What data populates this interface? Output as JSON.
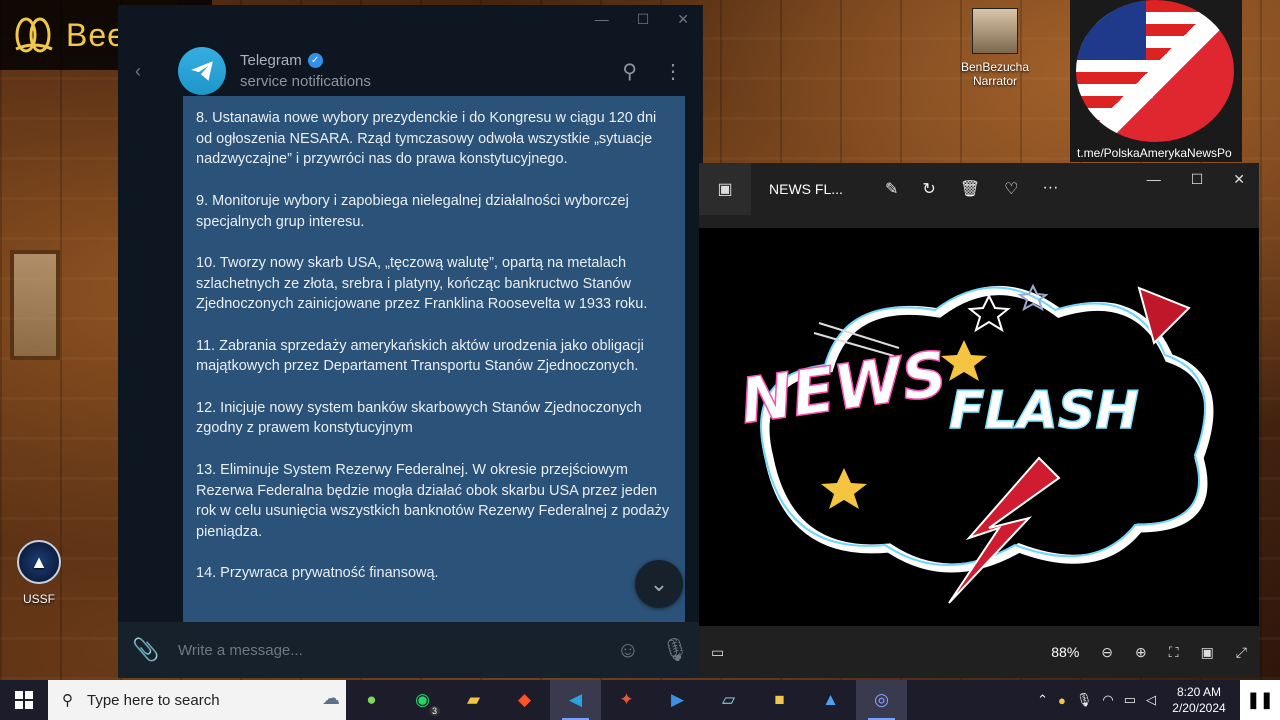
{
  "watermark": {
    "brand": "BeeCut"
  },
  "telegram": {
    "chat_name": "Telegram",
    "chat_status": "service notifications",
    "message_paragraphs": [
      "8. Ustanawia nowe wybory prezydenckie i do Kongresu w ciągu 120 dni od ogłoszenia NESARA. Rząd tymczasowy odwoła wszystkie „sytuacje nadzwyczajne” i przywróci nas do prawa konstytucyjnego.",
      "9. Monitoruje wybory i zapobiega nielegalnej działalności wyborczej specjalnych grup interesu.",
      "10. Tworzy nowy skarb USA, „tęczową walutę”, opartą na metalach szlachetnych ze złota, srebra i platyny, kończąc bankructwo Stanów Zjednoczonych zainicjowane przez Franklina Roosevelta w 1933 roku.",
      "11. Zabrania sprzedaży amerykańskich aktów urodzenia jako obligacji majątkowych przez Departament Transportu Stanów Zjednoczonych.",
      "12. Inicjuje nowy system banków skarbowych Stanów Zjednoczonych zgodny z prawem konstytucyjnym",
      "13. Eliminuje System Rezerwy Federalnej. W okresie przejściowym Rezerwa Federalna będzie mogła działać obok skarbu USA przez jeden rok w celu usunięcia wszystkich banknotów Rezerwy Federalnej z podaży pieniądza.",
      "14. Przywraca prywatność finansową."
    ],
    "composer_placeholder": "Write a message..."
  },
  "desktop": {
    "ussf_label": "USSF",
    "narrator_name": "BenBezucha",
    "narrator_role": "Narrator",
    "channel_url": "t.me/PolskaAmerykaNewsPo"
  },
  "photos": {
    "title": "NEWS FL...",
    "image_text_line1": "NEWS",
    "image_text_line2": "FLASH",
    "zoom": "88%"
  },
  "taskbar": {
    "search_placeholder": "Type here to search",
    "whatsapp_badge": "3",
    "time": "8:20 AM",
    "date": "2/20/2024"
  },
  "colors": {
    "telegram_bubble": "#2b5278",
    "telegram_bg": "#0e1621",
    "photos_bg": "#202020",
    "beecut_text": "#f2c84b"
  }
}
